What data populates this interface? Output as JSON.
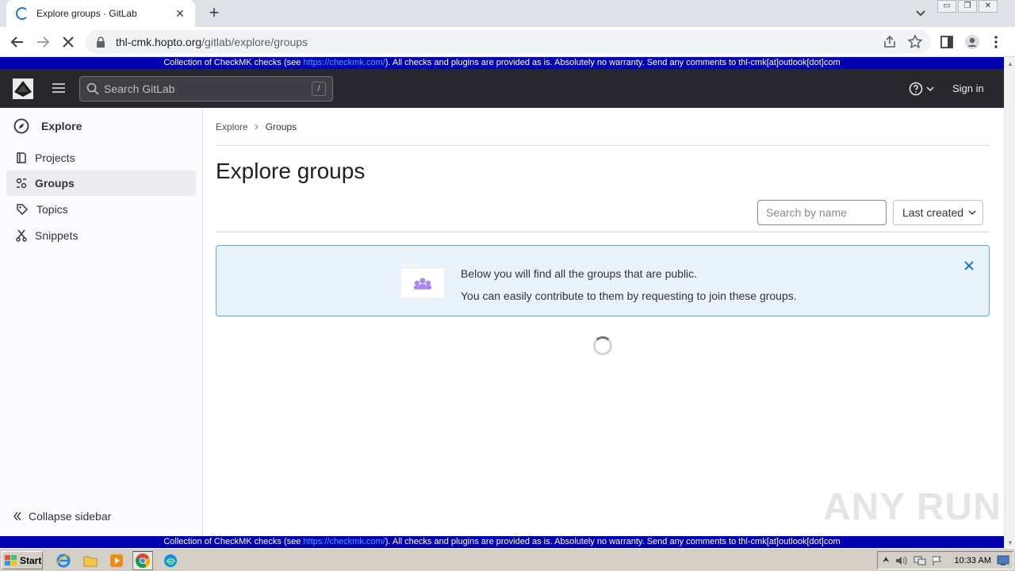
{
  "browser": {
    "tab_title": "Explore groups · GitLab",
    "tab_close": "✕",
    "new_tab": "+",
    "url_host": "thl-cmk.hopto.org",
    "url_path": "/gitlab/explore/groups",
    "window_controls": [
      "▭",
      "❐",
      "✕"
    ]
  },
  "banner": {
    "prefix": "Collection of CheckMK checks (see ",
    "link": "https://checkmk.com/",
    "suffix": "). All checks and plugins are provided as is. Absolutely no warranty. Send any comments to thl-cmk[at]outlook[dot]com"
  },
  "header": {
    "search_placeholder": "Search GitLab",
    "search_shortcut": "/",
    "sign_in": "Sign in"
  },
  "sidebar": {
    "context": "Explore",
    "items": [
      {
        "label": "Projects",
        "icon": "project-icon",
        "active": false
      },
      {
        "label": "Groups",
        "icon": "group-icon",
        "active": true
      },
      {
        "label": "Topics",
        "icon": "label-icon",
        "active": false
      },
      {
        "label": "Snippets",
        "icon": "snippet-icon",
        "active": false
      }
    ],
    "collapse": "Collapse sidebar"
  },
  "main": {
    "breadcrumb": [
      "Explore",
      "Groups"
    ],
    "title": "Explore groups",
    "filter_placeholder": "Search by name",
    "sort_label": "Last created",
    "alert_line1": "Below you will find all the groups that are public.",
    "alert_line2": "You can easily contribute to them by requesting to join these groups."
  },
  "watermark": "ANY RUN",
  "taskbar": {
    "start": "Start",
    "clock": "10:33 AM"
  },
  "colors": {
    "banner": "#0000b3",
    "gitlab_header": "#28272d",
    "alert_bg": "#e9f3fc",
    "alert_border": "#63a6e9",
    "alert_close": "#1f75cb"
  }
}
